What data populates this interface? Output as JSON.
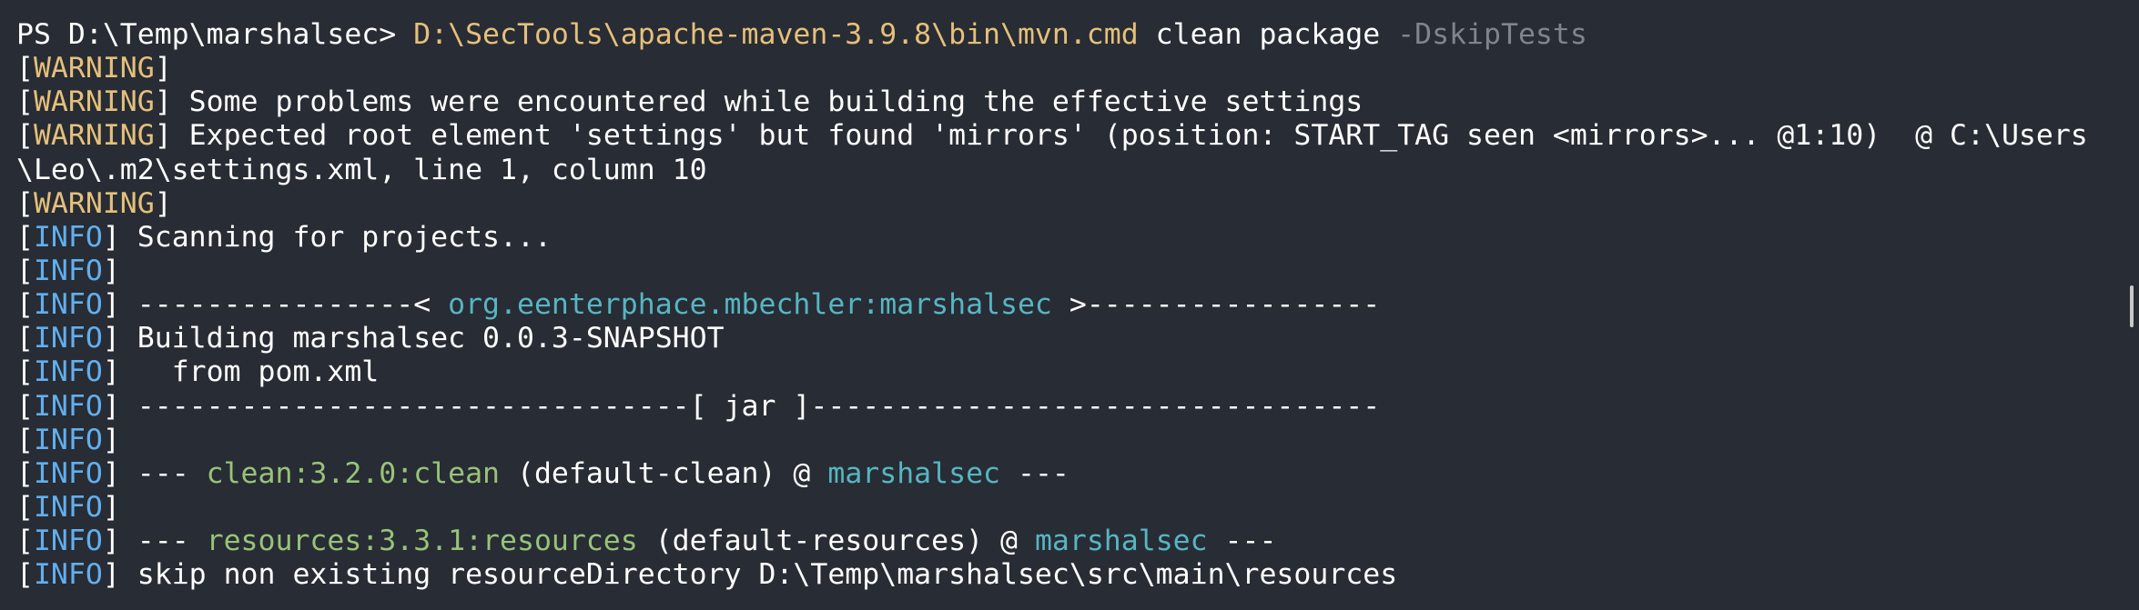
{
  "terminal": {
    "prompt": "PS D:\\Temp\\marshalsec> ",
    "command": "D:\\SecTools\\apache-maven-3.9.8\\bin\\mvn.cmd",
    "args": " clean package ",
    "flag": "-DskipTests",
    "warn_tag": "WARNING",
    "info_tag": "INFO",
    "warn_lines": [
      "",
      " Some problems were encountered while building the effective settings",
      " Expected root element 'settings' but found 'mirrors' (position: START_TAG seen <mirrors>... @1:10)  @ C:\\Users",
      "\\Leo\\.m2\\settings.xml, line 1, column 10",
      ""
    ],
    "scanning": " Scanning for projects...",
    "artifact_prefix": " ----------------< ",
    "artifact": "org.eenterphace.mbechler:marshalsec",
    "artifact_suffix": " >-----------------",
    "building": " Building marshalsec 0.0.3-SNAPSHOT",
    "from_pom": "   from pom.xml",
    "jar_line": " --------------------------------[ jar ]---------------------------------",
    "dashes": " --- ",
    "plugin_clean": "clean:3.2.0:clean",
    "exec_clean": " (default-clean) @ ",
    "plugin_resources": "resources:3.3.1:resources",
    "exec_resources": " (default-resources) @ ",
    "project": "marshalsec",
    "dashes_end": " ---",
    "skip_line": " skip non existing resourceDirectory D:\\Temp\\marshalsec\\src\\main\\resources"
  },
  "colors": {
    "background": "#282c34",
    "warning": "#e5c07b",
    "info": "#61afef",
    "artifact": "#56b6c2",
    "plugin": "#98c379",
    "flag": "#7f848e"
  }
}
